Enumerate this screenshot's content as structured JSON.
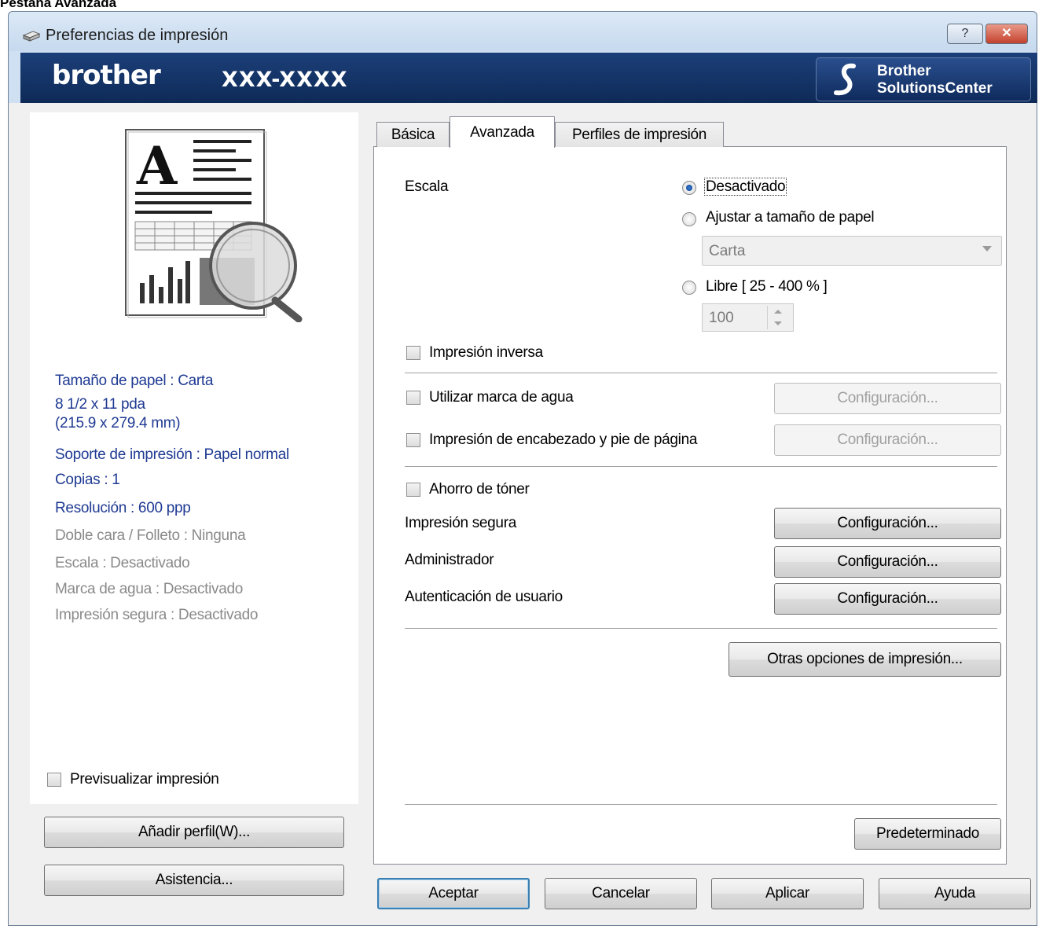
{
  "caption": "Pestaña Avanzada",
  "window": {
    "title": "Preferencias de impresión",
    "help_label": "?",
    "close_label": "✕"
  },
  "banner": {
    "brand": "brother",
    "model": "XXX-XXXX",
    "solutions_line1": "Brother",
    "solutions_line2": "SolutionsCenter"
  },
  "summary": {
    "paper_size": "Tamaño de papel : Carta",
    "paper_dims_1": "8 1/2 x 11 pda",
    "paper_dims_2": "(215.9 x 279.4 mm)",
    "media": "Soporte de impresión : Papel normal",
    "copies": "Copias : 1",
    "resolution": "Resolución : 600 ppp",
    "duplex": "Doble cara / Folleto : Ninguna",
    "scale": "Escala : Desactivado",
    "watermark": "Marca de agua : Desactivado",
    "secure": "Impresión segura : Desactivado"
  },
  "left_controls": {
    "preview_label": "Previsualizar impresión",
    "add_profile": "Añadir perfil(W)...",
    "support": "Asistencia..."
  },
  "tabs": [
    "Básica",
    "Avanzada",
    "Perfiles de impresión"
  ],
  "advanced": {
    "scale_label": "Escala",
    "radio_off": "Desactivado",
    "radio_fit": "Ajustar a tamaño de papel",
    "paper_combo_value": "Carta",
    "radio_free": "Libre [ 25 - 400 % ]",
    "free_value": "100",
    "reverse_print": "Impresión inversa",
    "watermark_label": "Utilizar marca de agua",
    "header_footer_label": "Impresión de encabezado y pie de página",
    "toner_save": "Ahorro de tóner",
    "secure_print": "Impresión segura",
    "administrator": "Administrador",
    "user_auth": "Autenticación de usuario",
    "config_label": "Configuración...",
    "other_options": "Otras opciones de impresión...",
    "default_button": "Predeterminado"
  },
  "footer": {
    "ok": "Aceptar",
    "cancel": "Cancelar",
    "apply": "Aplicar",
    "help": "Ayuda"
  }
}
